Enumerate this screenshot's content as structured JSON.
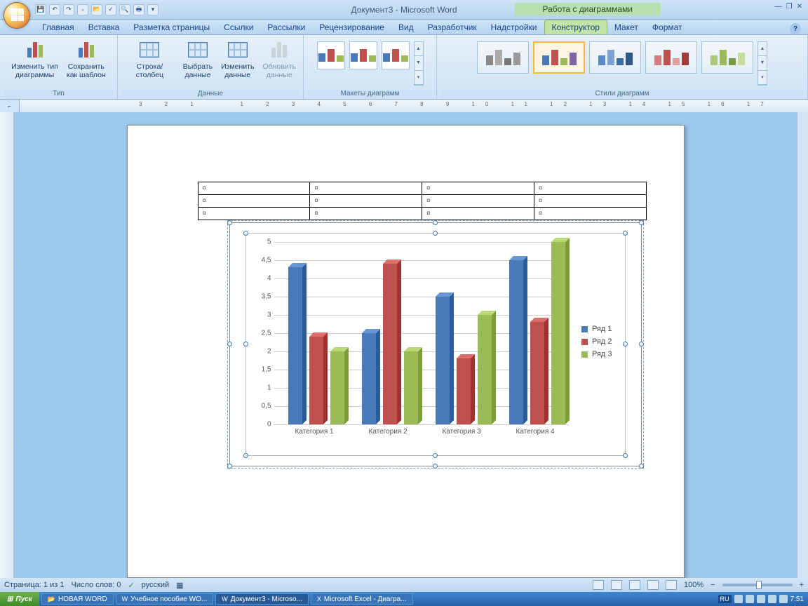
{
  "title": "Документ3 - Microsoft Word",
  "context_title": "Работа с диаграммами",
  "tabs": [
    "Главная",
    "Вставка",
    "Разметка страницы",
    "Ссылки",
    "Рассылки",
    "Рецензирование",
    "Вид",
    "Разработчик",
    "Надстройки"
  ],
  "context_tabs": [
    "Конструктор",
    "Макет",
    "Формат"
  ],
  "ribbon": {
    "type": {
      "label": "Тип",
      "change": "Изменить тип\nдиаграммы",
      "save": "Сохранить\nкак шаблон"
    },
    "data": {
      "label": "Данные",
      "switch": "Строка/столбец",
      "select": "Выбрать\nданные",
      "edit": "Изменить\nданные",
      "refresh": "Обновить\nданные"
    },
    "layouts": {
      "label": "Макеты диаграмм"
    },
    "styles": {
      "label": "Стили диаграмм"
    }
  },
  "chart_data": {
    "type": "bar",
    "categories": [
      "Категория 1",
      "Категория 2",
      "Категория 3",
      "Категория 4"
    ],
    "series": [
      {
        "name": "Ряд 1",
        "color": "#4a79b7",
        "values": [
          4.3,
          2.5,
          3.5,
          4.5
        ]
      },
      {
        "name": "Ряд 2",
        "color": "#c0504d",
        "values": [
          2.4,
          4.4,
          1.8,
          2.8
        ]
      },
      {
        "name": "Ряд 3",
        "color": "#9bbb59",
        "values": [
          2.0,
          2.0,
          3.0,
          5.0
        ]
      }
    ],
    "ylim": [
      0,
      5
    ],
    "ystep": 0.5,
    "title": "",
    "xlabel": "",
    "ylabel": ""
  },
  "status": {
    "page": "Страница: 1 из 1",
    "words": "Число слов: 0",
    "lang": "русский",
    "zoom": "100%"
  },
  "taskbar": {
    "start": "Пуск",
    "items": [
      {
        "label": "НОВАЯ WORD",
        "type": "folder"
      },
      {
        "label": "Учебное пособие WO...",
        "type": "word"
      },
      {
        "label": "Документ3 - Microso...",
        "type": "word",
        "active": true
      },
      {
        "label": "Microsoft Excel - Диагра...",
        "type": "excel"
      }
    ],
    "lang": "RU",
    "time": "7:51"
  }
}
